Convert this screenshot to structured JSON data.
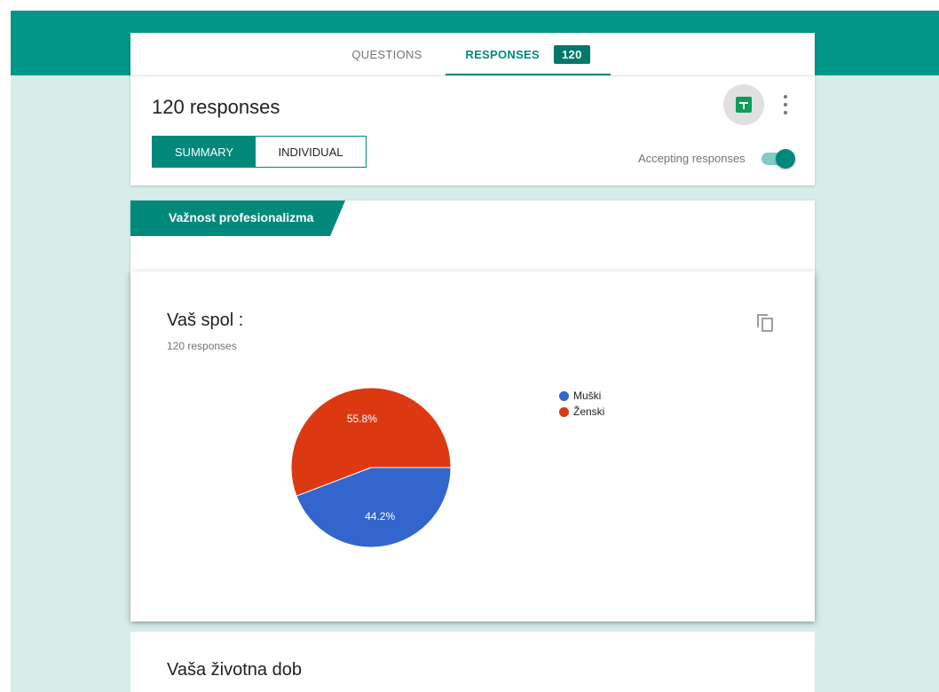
{
  "tabs": {
    "questions_label": "QUESTIONS",
    "responses_label": "RESPONSES",
    "responses_count": "120"
  },
  "summary_header": {
    "title": "120 responses",
    "summary_label": "SUMMARY",
    "individual_label": "INDIVIDUAL",
    "accepting_label": "Accepting responses",
    "accepting_on": true,
    "sheets_icon": "sheets-icon",
    "more_icon": "more-vert-icon"
  },
  "section": {
    "title": "Važnost profesionalizma"
  },
  "question": {
    "title": "Vaš spol :",
    "responses": "120 responses",
    "copy_icon": "copy-icon"
  },
  "chart_data": {
    "type": "pie",
    "categories": [
      "Muški",
      "Ženski"
    ],
    "values": [
      44.2,
      55.8
    ],
    "colors": [
      "#3366cc",
      "#dc3912"
    ],
    "data_labels": [
      "44.2%",
      "55.8%"
    ],
    "legend_position": "right"
  },
  "next_question": {
    "title": "Vaša životna dob"
  },
  "colors": {
    "primary": "#009688",
    "accent": "#00897b",
    "background": "#d7edea"
  }
}
